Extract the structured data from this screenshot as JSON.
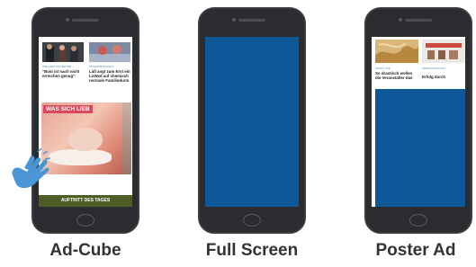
{
  "captions": {
    "ad_cube": "Ad-Cube",
    "full_screen": "Full Screen",
    "poster_ad": "Poster Ad"
  },
  "phone1": {
    "left_tag": "WIE GEHT ES WEITER",
    "left_quote": "\"Bust ist nach nicht erreichen genug\":",
    "right_tag": "LANDWIRTSCHAFT",
    "right_text": "Lidl angt zum Erst ein LoWed auf chemisch normale Familiedurm",
    "cube_label": "WAS SICH LIEB",
    "ad_bar": "AUFTRITT DES TAGES"
  },
  "phone3": {
    "left_tag": "STADT LIFE",
    "left_text": "So drastisch wollen die Veranstalter das",
    "right_tag": "VERANSTALTUNG",
    "right_text": "Erfolg durch"
  },
  "colors": {
    "ad_blue": "#0f5898",
    "phone_body": "#2a2c30",
    "hand_blue": "#4a95d6",
    "olive_bar": "#4d5d25"
  },
  "icons": {
    "hand": "tap-hand-icon"
  }
}
